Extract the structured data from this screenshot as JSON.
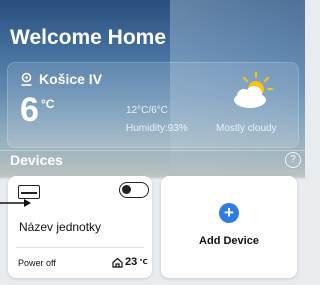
{
  "header": {
    "title": "Welcome Home"
  },
  "weather": {
    "location": "Košice IV",
    "temperature": "6",
    "unit": "°C",
    "range": "12°C/6°C",
    "humidity": "Humidity:93%",
    "condition": "Mostly cloudy",
    "icon": "partly-cloudy-icon"
  },
  "devices": {
    "title": "Devices",
    "help_icon": "help-icon",
    "items": [
      {
        "name": "Název jednotky",
        "power": "Power off",
        "temperature": "23",
        "temp_unit": "℃",
        "toggle_state": "off",
        "icon": "ac-unit-icon"
      }
    ],
    "add_label": "Add Device"
  },
  "colors": {
    "accent": "#2f7de1",
    "header_bg": "#1e4878",
    "card_bg": "#ffffff"
  }
}
